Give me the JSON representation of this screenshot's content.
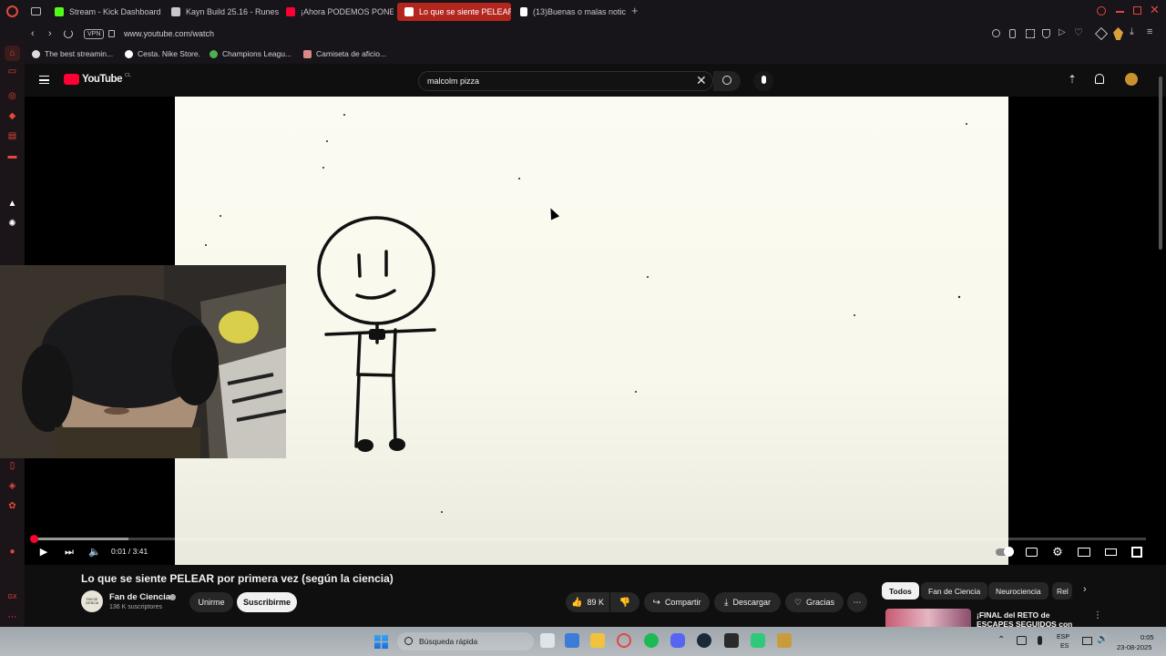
{
  "browser": {
    "tabs": [
      {
        "label": "Stream - Kick Dashboard",
        "color": "#53fc18"
      },
      {
        "label": "Kayn Build 25.16 - Runes,",
        "color": "#c8c8c8"
      },
      {
        "label": "¡Ahora PODEMOS PONER",
        "color": "#ff0033"
      },
      {
        "label": "Lo que se siente PELEAR",
        "color": "#ff0033"
      },
      {
        "label": "(13)Buenas o malas notic",
        "color": "#ffffff"
      }
    ],
    "vpn_label": "VPN",
    "url": "www.youtube.com/watch",
    "bookmarks": [
      {
        "label": "The best streamin..."
      },
      {
        "label": "Cesta. Nike Store."
      },
      {
        "label": "Champions Leagu..."
      },
      {
        "label": "Camiseta de aficio..."
      }
    ]
  },
  "youtube": {
    "logo_text": "YouTube",
    "region": "CL",
    "search_value": "malcolm pizza",
    "player": {
      "time": "0:01 / 3:41",
      "progress": 0.0045
    },
    "video_title": "Lo que se siente PELEAR por primera vez (según la ciencia)",
    "channel": {
      "name": "Fan de Ciencia",
      "subscribers": "136 K suscriptores",
      "avatar_text": "FAN DE CIENCIA"
    },
    "join_label": "Unirme",
    "subscribe_label": "Suscribirme",
    "likes": "89 K",
    "share_label": "Compartir",
    "download_label": "Descargar",
    "thanks_label": "Gracias",
    "chips": [
      "Todos",
      "Fan de Ciencia",
      "Neurociencia",
      "Rel"
    ],
    "next_video_title": "¡FINAL del RETO de ESCAPES SEGUIDOS con"
  },
  "taskbar": {
    "search_placeholder": "Búsqueda rápida",
    "lang_top": "ESP",
    "lang_bottom": "ES",
    "time": "0:05",
    "date": "23-08-2025"
  },
  "colors": {
    "accent": "#ff0033",
    "opera_red": "#e2493b"
  }
}
